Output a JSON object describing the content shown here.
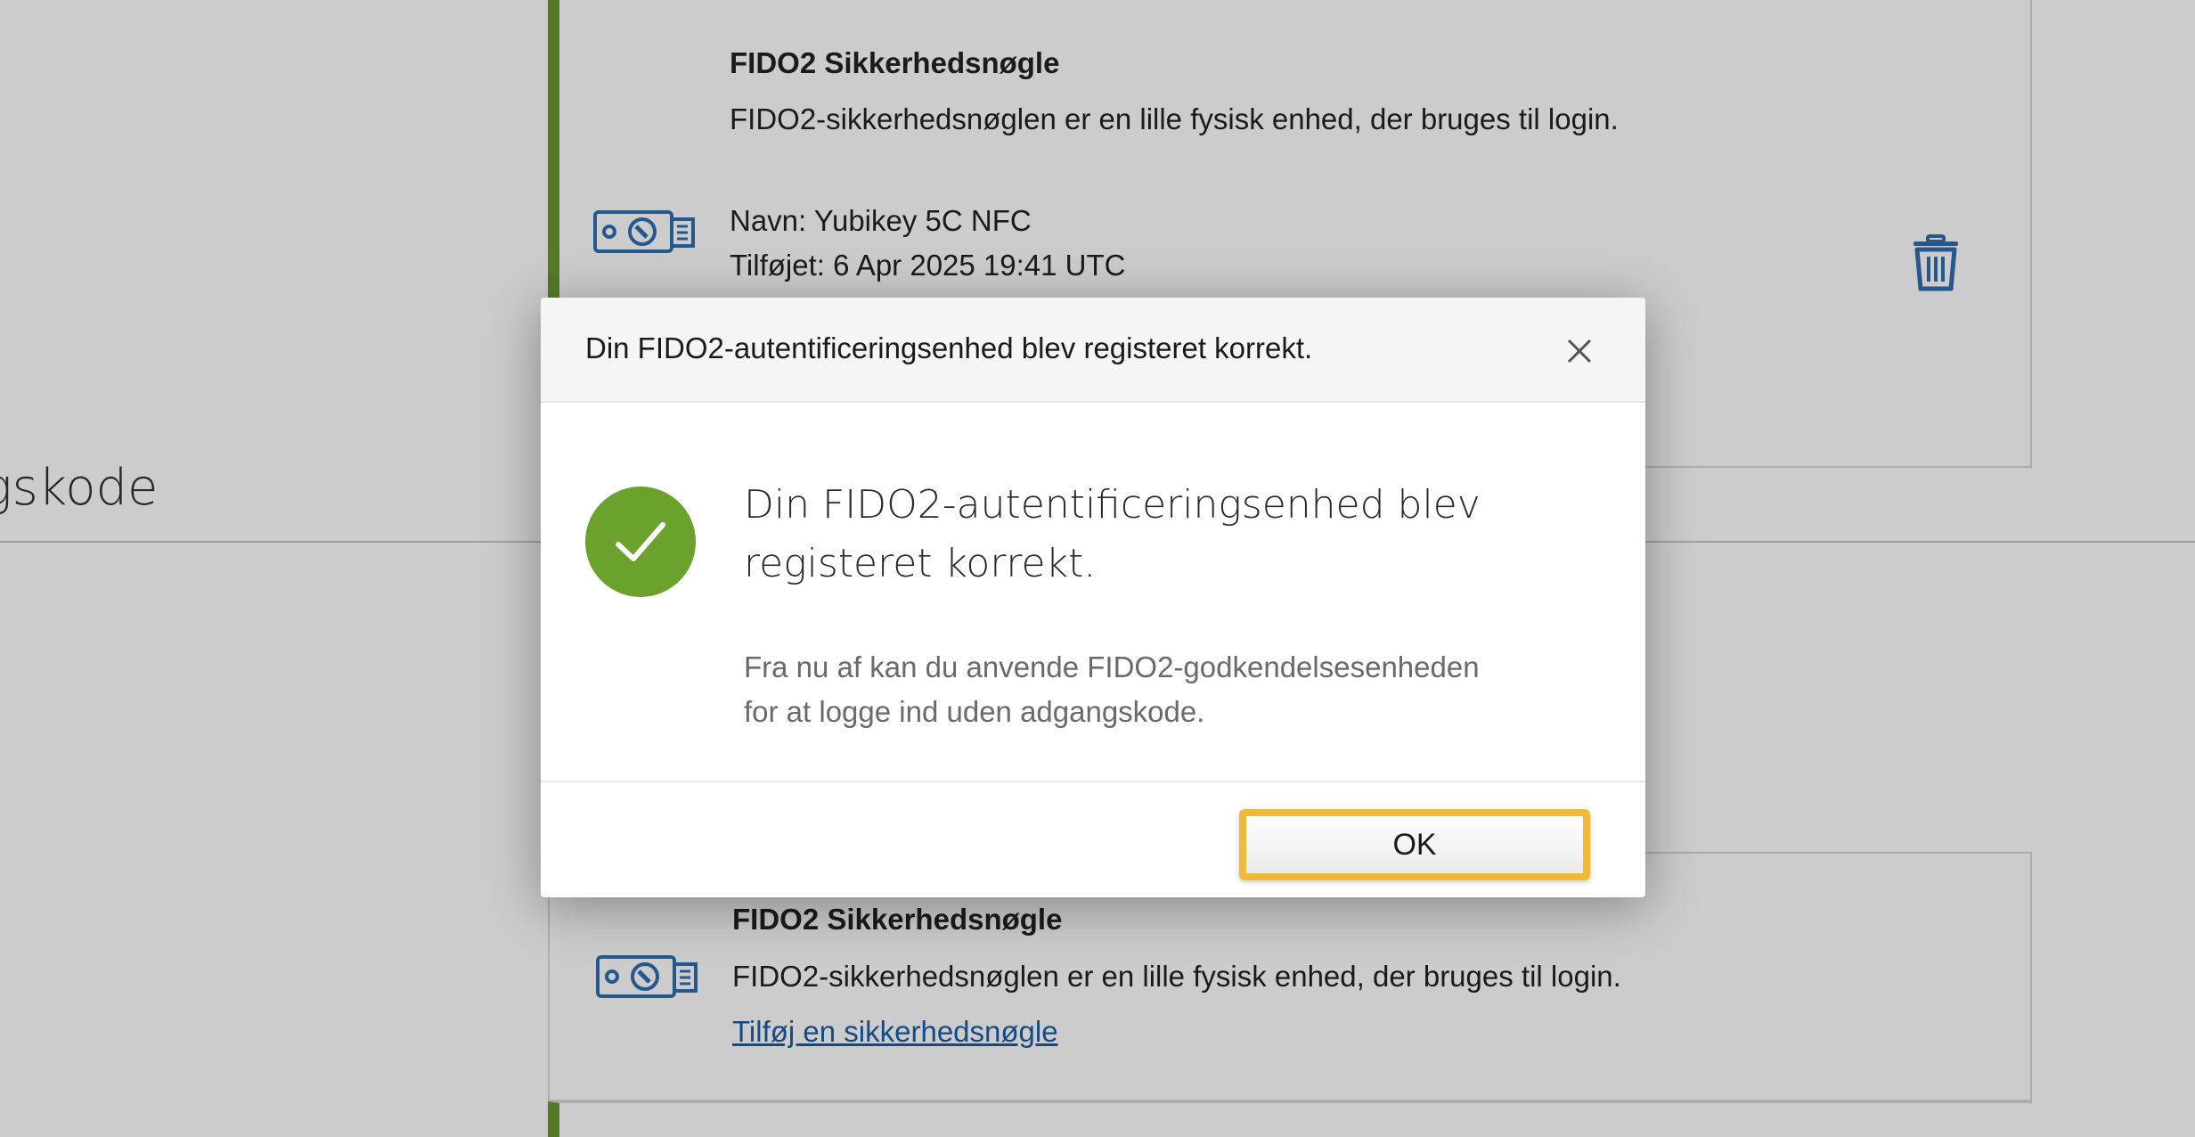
{
  "background": {
    "section_title": "gskode",
    "card_top": {
      "title": "FIDO2 Sikkerhedsnøgle",
      "description": "FIDO2-sikkerhedsnøglen er en lille fysisk enhed, der bruges til login.",
      "name_line": "Navn: Yubikey 5C NFC",
      "added_line": "Tilføjet: 6 Apr 2025 19:41 UTC",
      "icon": "security-key-icon",
      "delete_icon": "trash-icon"
    },
    "card_bottom": {
      "title": "FIDO2 Sikkerhedsnøgle",
      "description": "FIDO2-sikkerhedsnøglen er en lille fysisk enhed, der bruges til login.",
      "link_label": "Tilføj en sikkerhedsnøgle",
      "icon": "security-key-icon"
    }
  },
  "modal": {
    "header_title": "Din FIDO2-autentificeringsenhed blev registeret korrekt.",
    "close_icon": "close-icon",
    "success_icon": "checkmark-circle-icon",
    "heading": "Din FIDO2-autentificeringsenhed blev registeret korrekt.",
    "description_line1": "Fra nu af kan du anvende FIDO2-godkendelsesenheden",
    "description_line2": "for at logge ind uden adgangskode.",
    "ok_label": "OK"
  },
  "colors": {
    "accent_green": "#6a9a2e",
    "success_green": "#6aa22c",
    "link_blue": "#1a5ea8",
    "icon_blue": "#2f6fb0",
    "highlight_yellow": "#f0b93a"
  }
}
